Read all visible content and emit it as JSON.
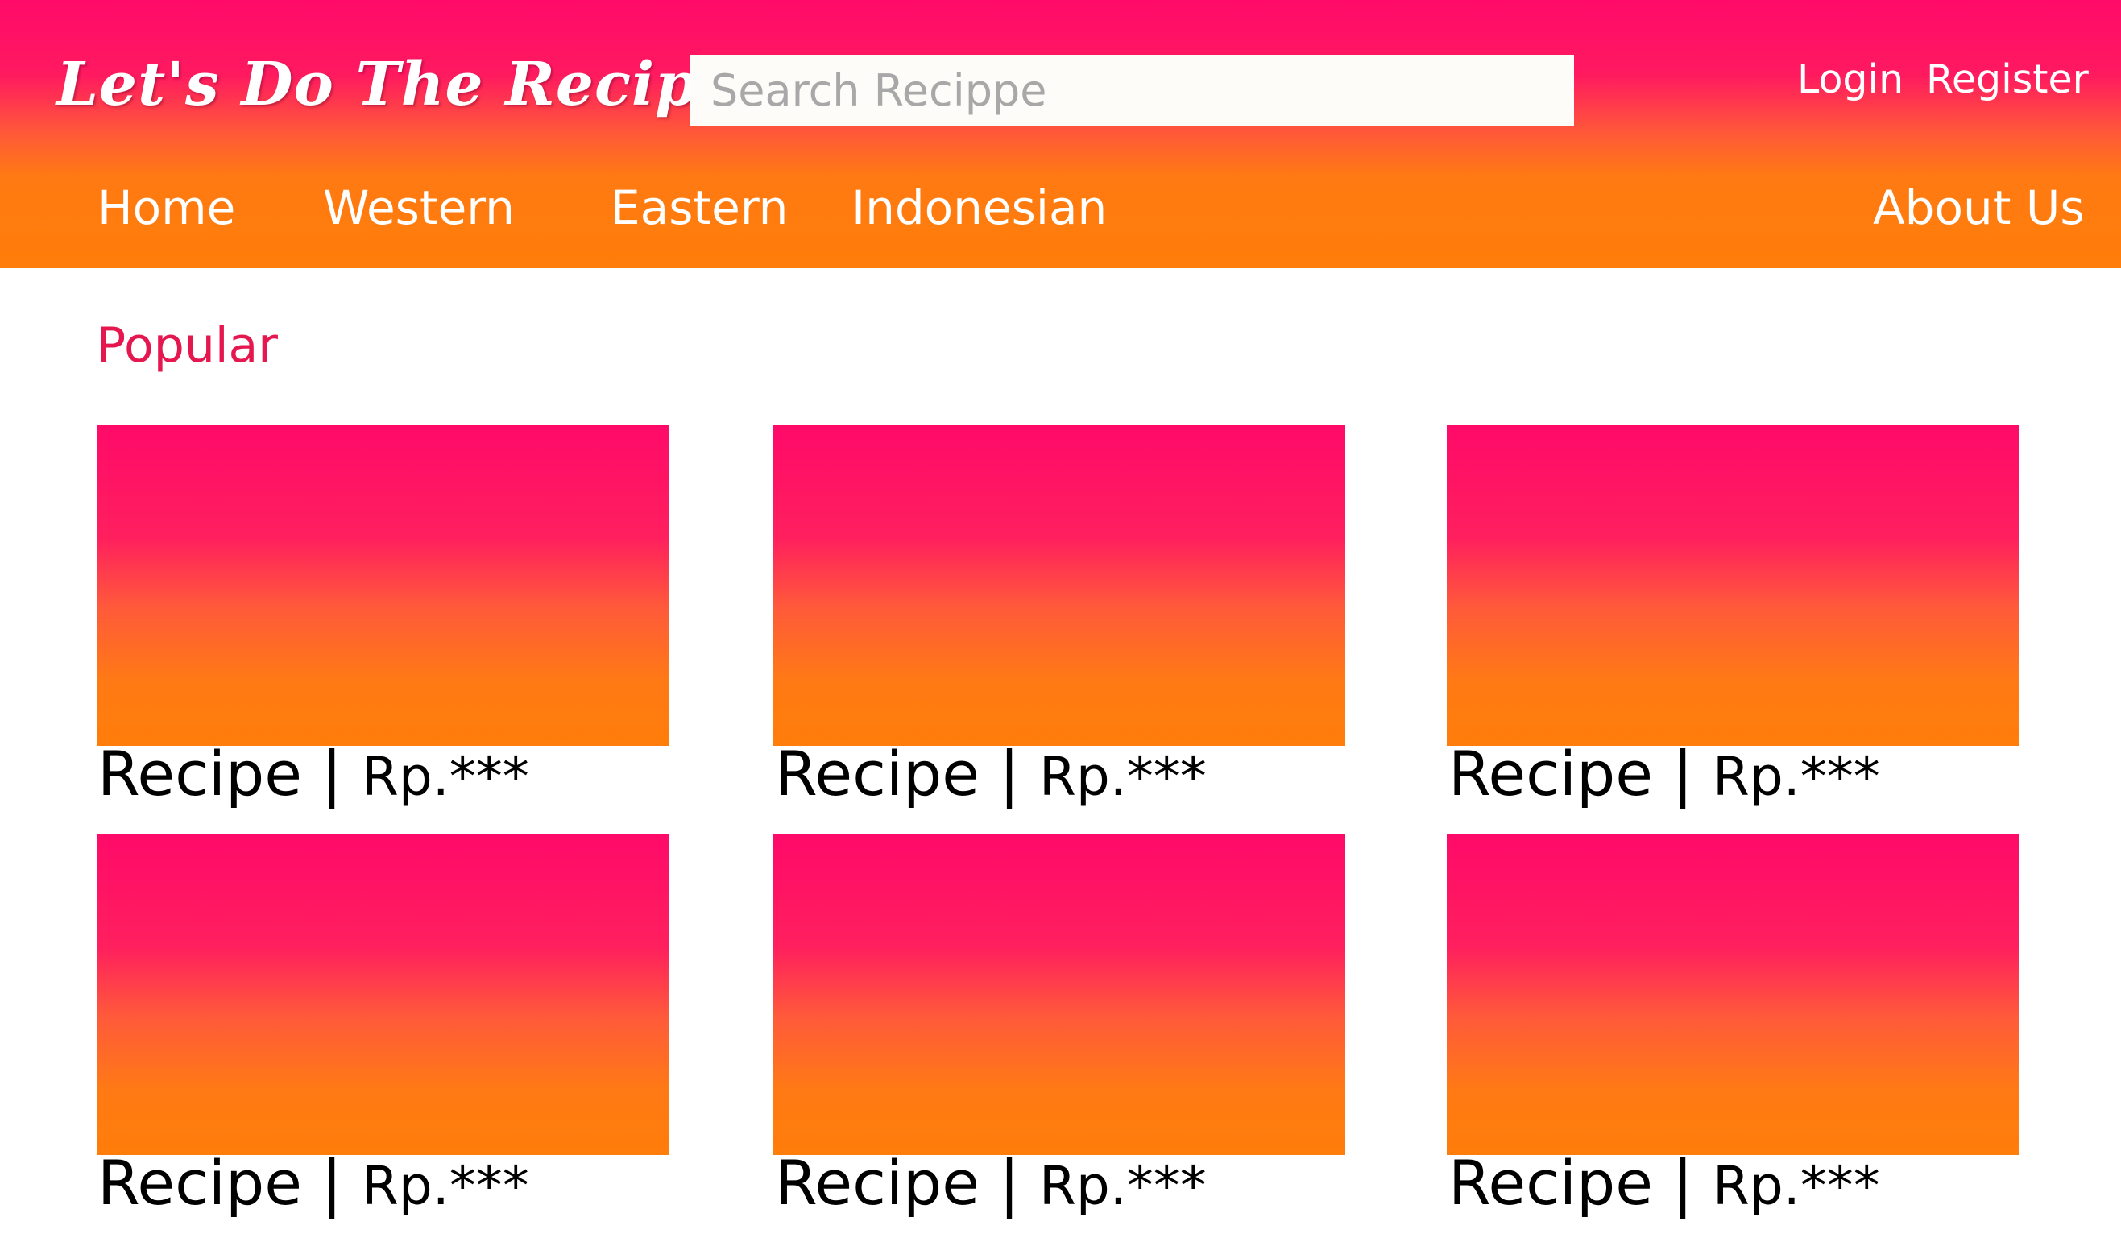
{
  "header": {
    "logo_text": "Let's Do The Recipe",
    "search_placeholder": "Search Recippe",
    "login_label": "Login",
    "register_label": "Register"
  },
  "nav": {
    "items": [
      {
        "label": "Home"
      },
      {
        "label": "Western"
      },
      {
        "label": "Eastern"
      },
      {
        "label": "Indonesian"
      },
      {
        "label": "About Us"
      }
    ]
  },
  "popular": {
    "title": "Popular",
    "cards": [
      {
        "name": "Recipe",
        "separator": " | ",
        "price": "Rp.***"
      },
      {
        "name": "Recipe",
        "separator": " | ",
        "price": "Rp.***"
      },
      {
        "name": "Recipe",
        "separator": " | ",
        "price": "Rp.***"
      },
      {
        "name": "Recipe",
        "separator": " | ",
        "price": "Rp.***"
      },
      {
        "name": "Recipe",
        "separator": " | ",
        "price": "Rp.***"
      },
      {
        "name": "Recipe",
        "separator": " | ",
        "price": "Rp.***"
      }
    ]
  },
  "colors": {
    "header_top": "#ff0a69",
    "header_bottom": "#ff7d0a",
    "section_title": "#e5174f"
  }
}
